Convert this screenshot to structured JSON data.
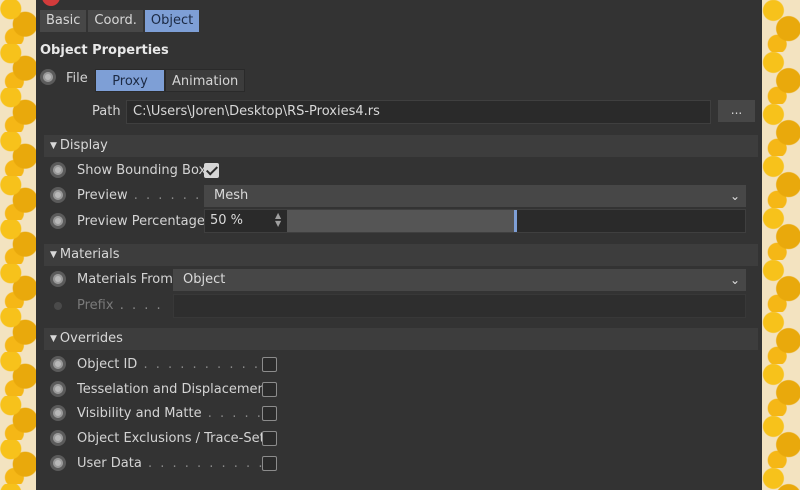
{
  "tabs": [
    "Basic",
    "Coord.",
    "Object"
  ],
  "active_tab": "Object",
  "section_title": "Object Properties",
  "file": {
    "label": "File",
    "modes": [
      "Proxy",
      "Animation"
    ],
    "active_mode": "Proxy",
    "path_label": "Path",
    "path_value": "C:\\Users\\Joren\\Desktop\\RS-Proxies4.rs",
    "browse_label": "..."
  },
  "display": {
    "header": "Display",
    "show_bbox_label": "Show Bounding Box",
    "show_bbox_checked": true,
    "preview_label": "Preview",
    "preview_value": "Mesh",
    "preview_pct_label": "Preview Percentage",
    "preview_pct_value": "50 %",
    "preview_pct_fraction": 0.5
  },
  "materials": {
    "header": "Materials",
    "from_label": "Materials From",
    "from_value": "Object",
    "prefix_label": "Prefix",
    "prefix_value": ""
  },
  "overrides": {
    "header": "Overrides",
    "items": [
      {
        "label": "Object ID",
        "checked": false
      },
      {
        "label": "Tesselation and Displacement",
        "checked": false
      },
      {
        "label": "Visibility and Matte",
        "checked": false
      },
      {
        "label": "Object Exclusions / Trace-Sets",
        "checked": false
      },
      {
        "label": "User Data",
        "checked": false
      }
    ]
  },
  "icons": {
    "triangle": "disclosure-triangle-icon",
    "chevron": "chevron-down-icon",
    "spinner": "spinner-arrows-icon"
  },
  "colors": {
    "panel_bg": "#333333",
    "accent": "#7e9fd6"
  }
}
